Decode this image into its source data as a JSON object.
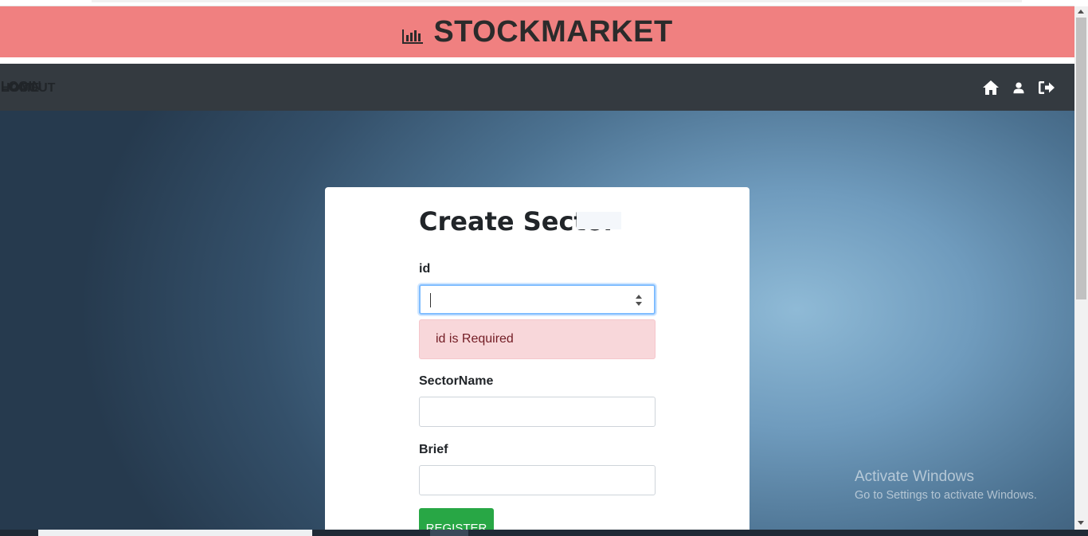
{
  "brand": {
    "title": "STOCKMARKET",
    "icon": "bar-chart-icon"
  },
  "nav": {
    "items": [
      {
        "label": "HOME",
        "icon": "home-icon"
      },
      {
        "label": "LOGIN",
        "icon": "user-icon"
      },
      {
        "label": "LOGOUT",
        "icon": "sign-out-icon"
      }
    ]
  },
  "form": {
    "title": "Create Sector",
    "fields": {
      "id": {
        "label": "id",
        "value": "",
        "type": "number"
      },
      "sector_name": {
        "label": "SectorName",
        "value": ""
      },
      "brief": {
        "label": "Brief",
        "value": ""
      }
    },
    "error": "id is Required",
    "submit_label": "REGISTER"
  },
  "watermark": {
    "line1": "Activate Windows",
    "line2": "Go to Settings to activate Windows."
  },
  "colors": {
    "brand_bar": "#f08080",
    "navbar": "#343a40",
    "alert_bg": "#f8d7da",
    "alert_text": "#721c24",
    "submit": "#28a745",
    "focus_border": "#80bdff"
  }
}
